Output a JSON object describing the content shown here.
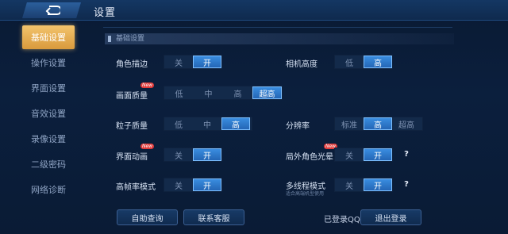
{
  "header": {
    "title": "设置"
  },
  "sidebar": {
    "items": [
      {
        "label": "基础设置",
        "active": true
      },
      {
        "label": "操作设置"
      },
      {
        "label": "界面设置"
      },
      {
        "label": "音效设置"
      },
      {
        "label": "录像设置"
      },
      {
        "label": "二级密码"
      },
      {
        "label": "网络诊断"
      }
    ]
  },
  "section": {
    "title": "基础设置"
  },
  "settings": {
    "outline": {
      "label": "角色描边",
      "options": [
        "关",
        "开"
      ],
      "selected": "开"
    },
    "camera": {
      "label": "相机高度",
      "options": [
        "低",
        "高"
      ],
      "selected": "高"
    },
    "quality": {
      "label": "画面质量",
      "badge": "New",
      "options": [
        "低",
        "中",
        "高",
        "超高"
      ],
      "selected": "超高"
    },
    "particle": {
      "label": "粒子质量",
      "options": [
        "低",
        "中",
        "高"
      ],
      "selected": "高"
    },
    "resolution": {
      "label": "分辨率",
      "options": [
        "标准",
        "高",
        "超高"
      ],
      "selected": "高"
    },
    "ui_anim": {
      "label": "界面动画",
      "badge": "New",
      "options": [
        "关",
        "开"
      ],
      "selected": "开"
    },
    "halo": {
      "label": "局外角色光晕",
      "badge": "New",
      "options": [
        "关",
        "开"
      ],
      "selected": "开",
      "help": "?"
    },
    "hfr": {
      "label": "高帧率模式",
      "options": [
        "关",
        "开"
      ],
      "selected": "开"
    },
    "multithread": {
      "label": "多线程模式",
      "sublabel": "适合高端机型使用",
      "options": [
        "关",
        "开"
      ],
      "selected": "开",
      "help": "?"
    }
  },
  "footer": {
    "self_help": "自助查询",
    "contact": "联系客服",
    "login_status": "已登录QQ",
    "logout": "退出登录"
  },
  "colors": {
    "accent": "#2f7fd6",
    "active_tab": "#e8b25a"
  }
}
